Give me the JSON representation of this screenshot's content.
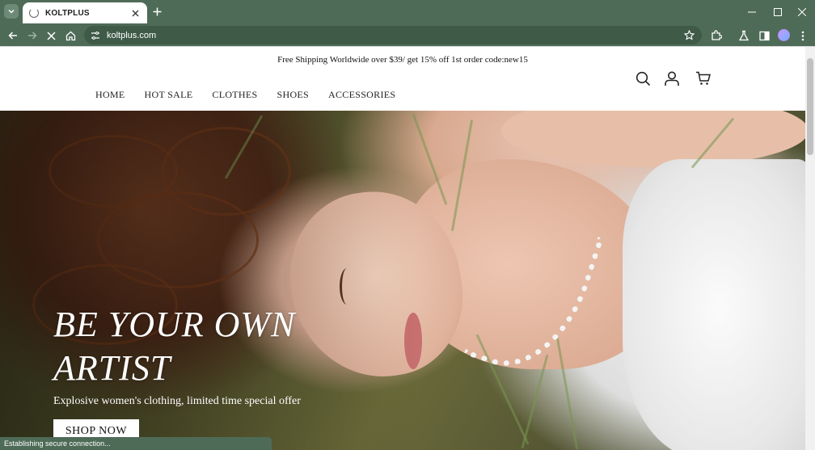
{
  "browser": {
    "tab_title": "KOLTPLUS",
    "url": "koltplus.com",
    "status_text": "Establishing secure connection..."
  },
  "page": {
    "announcement": "Free Shipping Worldwide over $39/ get 15% off 1st order code:new15",
    "nav": [
      "HOME",
      "HOT SALE",
      "CLOTHES",
      "SHOES",
      "ACCESSORIES"
    ],
    "hero": {
      "headline_line1": "BE YOUR OWN",
      "headline_line2": "ARTIST",
      "subline": "Explosive women's clothing, limited time special offer",
      "cta": "SHOP NOW"
    }
  },
  "colors": {
    "chrome": "#4e6b57",
    "omnibox": "#3f5b48"
  },
  "icons": [
    "tab-search-icon",
    "close-icon",
    "new-tab-icon",
    "back-icon",
    "forward-icon",
    "stop-icon",
    "home-icon",
    "site-info-icon",
    "star-icon",
    "extensions-icon",
    "labs-icon",
    "side-panel-icon",
    "menu-icon",
    "search-icon",
    "account-icon",
    "cart-icon"
  ]
}
